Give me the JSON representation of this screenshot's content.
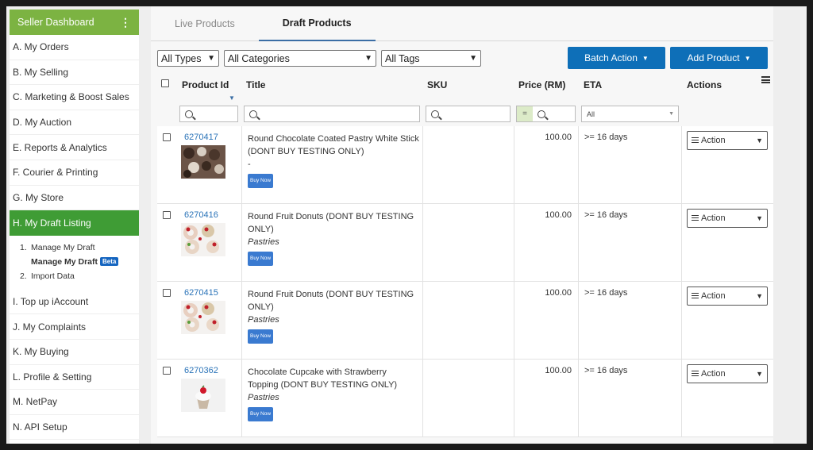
{
  "sidebar": {
    "header": "Seller Dashboard",
    "items_top": [
      {
        "label": "A. My Orders"
      },
      {
        "label": "B. My Selling"
      },
      {
        "label": "C. Marketing & Boost Sales"
      },
      {
        "label": "D. My Auction"
      },
      {
        "label": "E. Reports & Analytics"
      },
      {
        "label": "F. Courier & Printing"
      },
      {
        "label": "G. My Store"
      }
    ],
    "active_item": "H. My Draft Listing",
    "sub": {
      "n1": "1.",
      "item1": "Manage My Draft",
      "item_bold": "Manage My Draft",
      "beta": "Beta",
      "n2": "2.",
      "item2": "Import Data"
    },
    "items_bottom": [
      {
        "label": "I.  Top up iAccount"
      },
      {
        "label": "J.  My Complaints"
      },
      {
        "label": "K. My Buying"
      },
      {
        "label": "L.  Profile & Setting"
      },
      {
        "label": "M. NetPay"
      },
      {
        "label": "N. API Setup"
      }
    ]
  },
  "tabs": {
    "live": "Live Products",
    "draft": "Draft Products"
  },
  "filters": {
    "types": "All Types",
    "categories": "All Categories",
    "tags": "All Tags"
  },
  "buttons": {
    "batch": "Batch Action",
    "add": "Add Product"
  },
  "table": {
    "headers": {
      "product_id": "Product Id",
      "title": "Title",
      "sku": "SKU",
      "price": "Price (RM)",
      "eta": "ETA",
      "actions": "Actions"
    },
    "price_eq": "=",
    "eta_filter": "All",
    "rows": [
      {
        "id": "6270417",
        "title": "Round Chocolate Coated Pastry White Stick (DONT BUY TESTING ONLY)",
        "category": "-",
        "buy": "Buy Now",
        "price": "100.00",
        "eta": ">= 16 days",
        "action": "Action"
      },
      {
        "id": "6270416",
        "title": "Round Fruit Donuts (DONT BUY TESTING ONLY)",
        "category": "Pastries",
        "buy": "Buy Now",
        "price": "100.00",
        "eta": ">= 16 days",
        "action": "Action"
      },
      {
        "id": "6270415",
        "title": "Round Fruit Donuts (DONT BUY TESTING ONLY)",
        "category": "Pastries",
        "buy": "Buy Now",
        "price": "100.00",
        "eta": ">= 16 days",
        "action": "Action"
      },
      {
        "id": "6270362",
        "title": "Chocolate Cupcake with Strawberry Topping (DONT BUY TESTING ONLY)",
        "category": "Pastries",
        "buy": "Buy Now",
        "price": "100.00",
        "eta": ">= 16 days",
        "action": "Action"
      }
    ]
  },
  "colors": {
    "sidebar_header": "#7cb342",
    "sidebar_active": "#3f9c35",
    "button": "#0e6fb8",
    "link": "#2a73b8"
  }
}
